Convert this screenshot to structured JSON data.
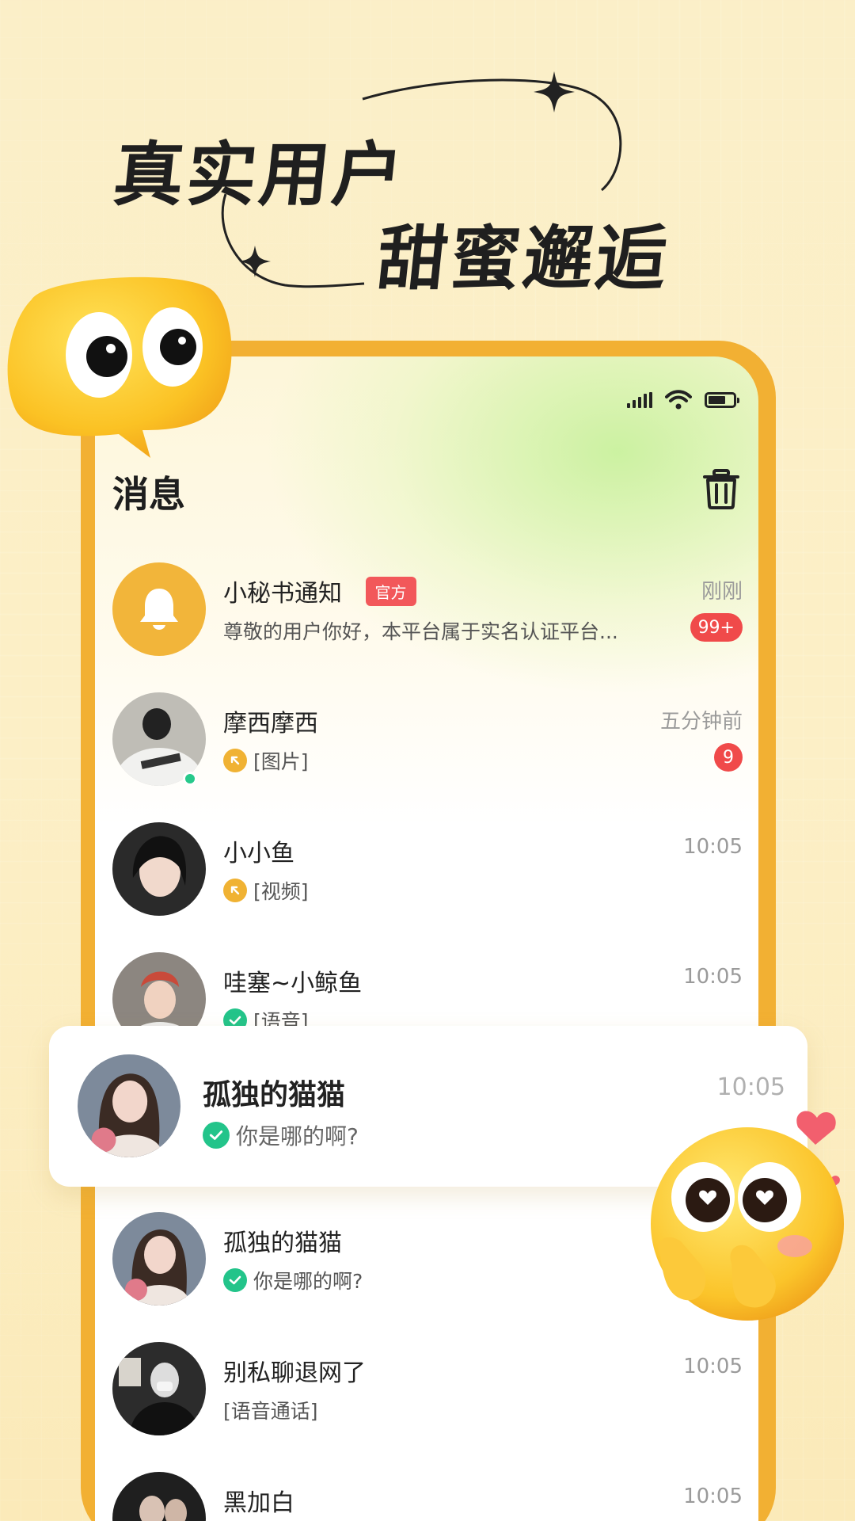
{
  "headline": {
    "line1": "真实用户",
    "line2": "甜蜜邂逅"
  },
  "screen": {
    "title": "消息",
    "trash_icon": "trash-icon"
  },
  "messages": [
    {
      "name": "小秘书通知",
      "tag": "官方",
      "preview": "尊敬的用户你好，本平台属于实名认证平台...",
      "time": "刚刚",
      "badge": "99+",
      "avatar": "bell-icon",
      "avatar_color": "#f2b53a"
    },
    {
      "name": "摩西摩西",
      "preview": "[图片]",
      "time": "五分钟前",
      "badge": "9",
      "preview_icon": "arrow-up-left-icon",
      "online": true
    },
    {
      "name": "小小鱼",
      "preview": "[视频]",
      "time": "10:05",
      "preview_icon": "arrow-up-left-icon"
    },
    {
      "name": "哇塞~小鲸鱼",
      "preview": "[语音]",
      "time": "10:05",
      "preview_icon": "check-icon"
    },
    {
      "name": "孤独的猫猫",
      "preview": "你是哪的啊?",
      "time": "10:05",
      "preview_icon": "check-icon"
    },
    {
      "name": "孤独的猫猫",
      "preview": "你是哪的啊?",
      "time": "10:05",
      "preview_icon": "check-icon"
    },
    {
      "name": "别私聊退网了",
      "preview": "[语音通话]",
      "time": "10:05"
    },
    {
      "name": "黑加白",
      "time": "10:05"
    }
  ],
  "colors": {
    "accent": "#f2b033",
    "badge": "#f04a4a",
    "check": "#23c48a",
    "background": "#fbeec4"
  }
}
